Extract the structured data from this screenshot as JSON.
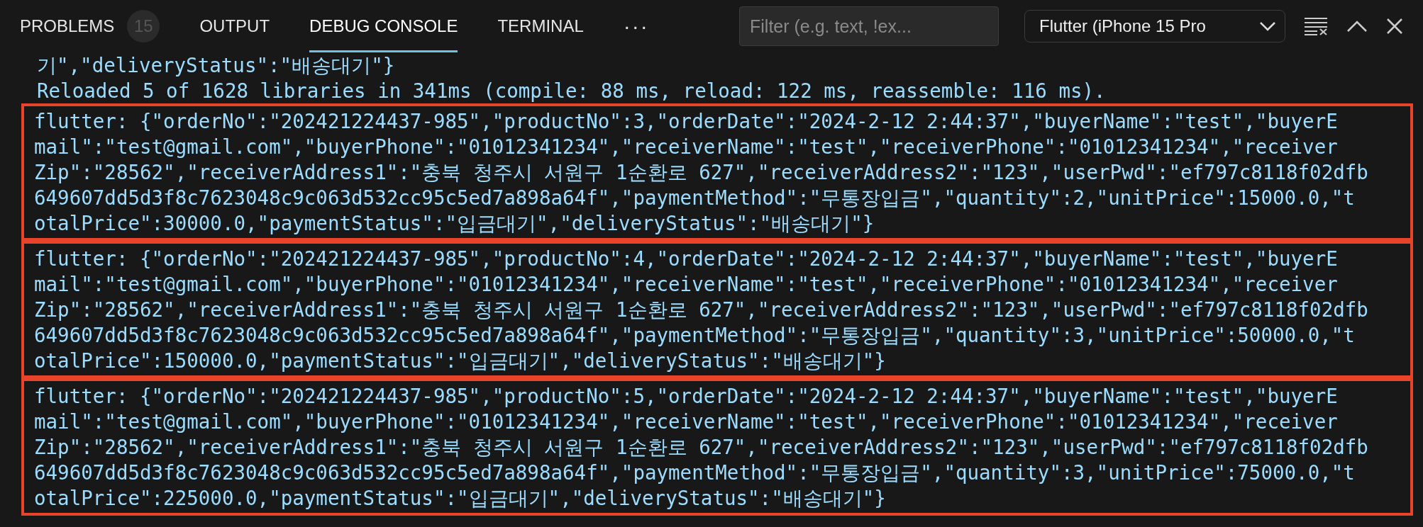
{
  "tabs": [
    {
      "label": "PROBLEMS",
      "badge": "15",
      "selected": false
    },
    {
      "label": "OUTPUT",
      "selected": false
    },
    {
      "label": "DEBUG CONSOLE",
      "selected": true
    },
    {
      "label": "TERMINAL",
      "selected": false
    }
  ],
  "more": "···",
  "filter": {
    "placeholder": "Filter (e.g. text, !ex..."
  },
  "session": {
    "value": "Flutter (iPhone 15 Pro"
  },
  "console": {
    "partial_line": "기\",\"deliveryStatus\":\"배송대기\"}",
    "reload_line": "Reloaded 5 of 1628 libraries in 341ms (compile: 88 ms, reload: 122 ms, reassemble: 116 ms).",
    "entries": [
      {
        "highlighted": true,
        "lines": [
          "flutter: {\"orderNo\":\"202421224437-985\",\"productNo\":3,\"orderDate\":\"2024-2-12 2:44:37\",\"buyerName\":\"test\",\"buyerE",
          "mail\":\"test@gmail.com\",\"buyerPhone\":\"01012341234\",\"receiverName\":\"test\",\"receiverPhone\":\"01012341234\",\"receiver",
          "Zip\":\"28562\",\"receiverAddress1\":\"충북 청주시 서원구 1순환로 627\",\"receiverAddress2\":\"123\",\"userPwd\":\"ef797c8118f02dfb",
          "649607dd5d3f8c7623048c9c063d532cc95c5ed7a898a64f\",\"paymentMethod\":\"무통장입금\",\"quantity\":2,\"unitPrice\":15000.0,\"t",
          "otalPrice\":30000.0,\"paymentStatus\":\"입금대기\",\"deliveryStatus\":\"배송대기\"}"
        ]
      },
      {
        "highlighted": true,
        "lines": [
          "flutter: {\"orderNo\":\"202421224437-985\",\"productNo\":4,\"orderDate\":\"2024-2-12 2:44:37\",\"buyerName\":\"test\",\"buyerE",
          "mail\":\"test@gmail.com\",\"buyerPhone\":\"01012341234\",\"receiverName\":\"test\",\"receiverPhone\":\"01012341234\",\"receiver",
          "Zip\":\"28562\",\"receiverAddress1\":\"충북 청주시 서원구 1순환로 627\",\"receiverAddress2\":\"123\",\"userPwd\":\"ef797c8118f02dfb",
          "649607dd5d3f8c7623048c9c063d532cc95c5ed7a898a64f\",\"paymentMethod\":\"무통장입금\",\"quantity\":3,\"unitPrice\":50000.0,\"t",
          "otalPrice\":150000.0,\"paymentStatus\":\"입금대기\",\"deliveryStatus\":\"배송대기\"}"
        ]
      },
      {
        "highlighted": true,
        "lines": [
          "flutter: {\"orderNo\":\"202421224437-985\",\"productNo\":5,\"orderDate\":\"2024-2-12 2:44:37\",\"buyerName\":\"test\",\"buyerE",
          "mail\":\"test@gmail.com\",\"buyerPhone\":\"01012341234\",\"receiverName\":\"test\",\"receiverPhone\":\"01012341234\",\"receiver",
          "Zip\":\"28562\",\"receiverAddress1\":\"충북 청주시 서원구 1순환로 627\",\"receiverAddress2\":\"123\",\"userPwd\":\"ef797c8118f02dfb",
          "649607dd5d3f8c7623048c9c063d532cc95c5ed7a898a64f\",\"paymentMethod\":\"무통장입금\",\"quantity\":3,\"unitPrice\":75000.0,\"t",
          "otalPrice\":225000.0,\"paymentStatus\":\"입금대기\",\"deliveryStatus\":\"배송대기\"}"
        ]
      }
    ]
  }
}
